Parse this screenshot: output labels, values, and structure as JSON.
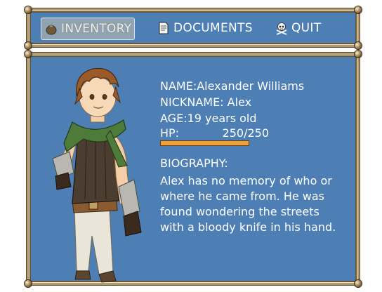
{
  "menu": {
    "items": [
      {
        "label": "INVENTORY",
        "icon": "bag-icon",
        "selected": true
      },
      {
        "label": "DOCUMENTS",
        "icon": "document-icon",
        "selected": false
      },
      {
        "label": "QUIT",
        "icon": "skull-crossbones-icon",
        "selected": false
      }
    ]
  },
  "character": {
    "name_label": "NAME:",
    "name": "Alexander Williams",
    "nickname_label": "NICKNAME:",
    "nickname": "Alex",
    "age_label": "AGE:",
    "age": "19 years old",
    "hp_label": "HP:",
    "hp_text": "250/250",
    "hp_current": 250,
    "hp_max": 250,
    "biography_label": "BIOGRAPHY:",
    "biography": "Alex has no memory of who or where he came from. He was found wondering the streets with a bloody knife in his hand."
  },
  "colors": {
    "panel_bg": "#4d7fb5",
    "frame": "#b19a6e",
    "hp_fill": "#f2a13a",
    "hp_track": "#7b5b2a",
    "text": "#ffffff"
  }
}
